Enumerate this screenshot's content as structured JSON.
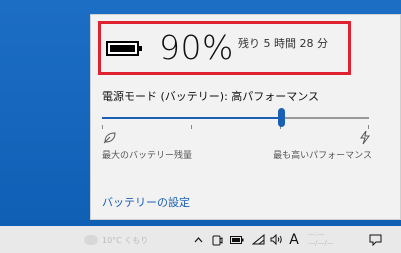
{
  "battery": {
    "percent": "90%",
    "remaining": "残り 5 時間 28 分"
  },
  "power_mode": {
    "label": "電源モード (バッテリー): 高パフォーマンス",
    "slider_value": 0.67,
    "left_label": "最大のバッテリー残量",
    "right_label": "最も高いパフォーマンス"
  },
  "links": {
    "battery_settings": "バッテリーの設定"
  },
  "taskbar": {
    "ime_label": "A",
    "weather_text": "10°C くもり",
    "time_text": "—:—",
    "date_text": "—/—/—"
  },
  "colors": {
    "accent": "#1a5fb4",
    "highlight": "#e0212f",
    "desktop": "#1565c0"
  }
}
